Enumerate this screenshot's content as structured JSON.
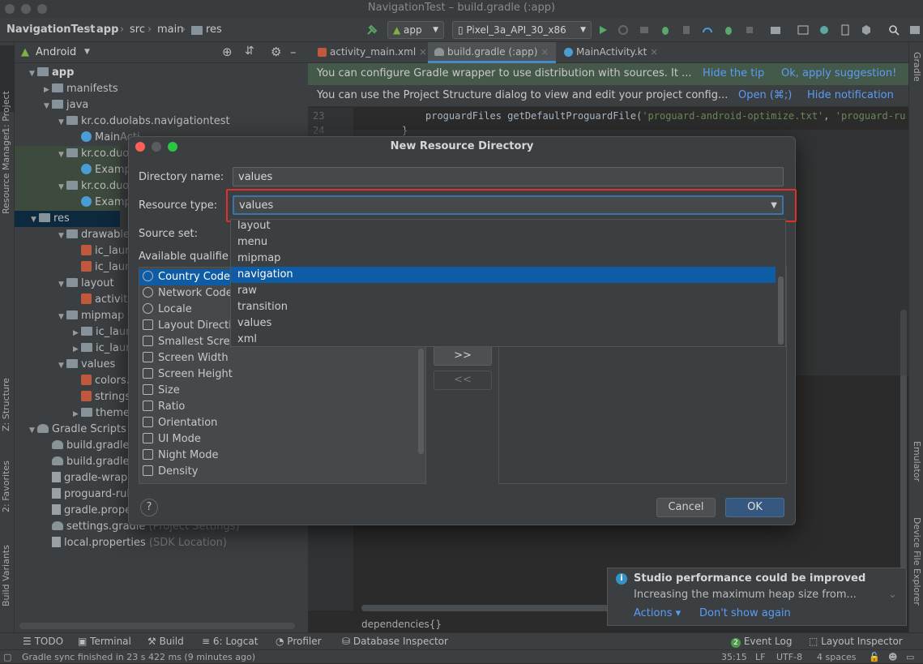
{
  "window": {
    "title": "NavigationTest – build.gradle (:app)"
  },
  "breadcrumb": {
    "items": [
      "NavigationTest",
      "app",
      "src",
      "main",
      "res"
    ]
  },
  "toolbar": {
    "run_config": "app",
    "device": "Pixel_3a_API_30_x86"
  },
  "project_panel": {
    "view_selector": "Android",
    "tree": [
      {
        "label": "app",
        "level": 0
      },
      {
        "label": "manifests",
        "level": 1
      },
      {
        "label": "java",
        "level": 1
      },
      {
        "label": "kr.co.duolabs.navigationtest",
        "level": 2
      },
      {
        "label": "MainActi",
        "level": 3
      },
      {
        "label": "kr.co.duola",
        "level": 2
      },
      {
        "label": "Exampl",
        "level": 3
      },
      {
        "label": "kr.co.duola",
        "level": 2
      },
      {
        "label": "Exampl",
        "level": 3
      },
      {
        "label": "res",
        "level": 1
      },
      {
        "label": "drawable",
        "level": 2
      },
      {
        "label": "ic_laun",
        "level": 3
      },
      {
        "label": "ic_laun",
        "level": 3
      },
      {
        "label": "layout",
        "level": 2
      },
      {
        "label": "activity",
        "level": 3
      },
      {
        "label": "mipmap",
        "level": 2
      },
      {
        "label": "ic_laun",
        "level": 3
      },
      {
        "label": "ic_laun",
        "level": 3
      },
      {
        "label": "values",
        "level": 2
      },
      {
        "label": "colors.x",
        "level": 3
      },
      {
        "label": "strings.",
        "level": 3
      },
      {
        "label": "themes",
        "level": 3
      },
      {
        "label": "Gradle Scripts",
        "level": 0
      },
      {
        "label": "build.gradle",
        "level": 1
      },
      {
        "label": "build.gradle",
        "level": 1
      },
      {
        "label": "gradle-wrap",
        "level": 1
      },
      {
        "label": "proguard-rul",
        "level": 1
      },
      {
        "label": "gradle.prope",
        "level": 1
      },
      {
        "label": "settings.gradle",
        "level": 1,
        "suffix": "(Project Settings)"
      },
      {
        "label": "local.properties",
        "level": 1,
        "suffix": "(SDK Location)"
      }
    ]
  },
  "side_tabs": {
    "left": [
      "1: Project",
      "Resource Manager",
      "Z: Structure",
      "2: Favorites",
      "Build Variants"
    ],
    "right": [
      "Gradle",
      "Emulator",
      "Device File Explorer"
    ]
  },
  "editor": {
    "tabs": [
      "activity_main.xml",
      "build.gradle (:app)",
      "MainActivity.kt"
    ],
    "banner1": {
      "text": "You can configure Gradle wrapper to use distribution with sources. It ...",
      "link1": "Hide the tip",
      "link2": "Ok, apply suggestion!"
    },
    "banner2": {
      "text": "You can use the Project Structure dialog to view and edit your project config...",
      "link1": "Open (⌘;)",
      "link2": "Hide notification"
    },
    "line_numbers": [
      "23",
      "24"
    ],
    "code_line": "proguardFiles getDefaultProguardFile(",
    "code_str1": "'proguard-android-optimize.txt'",
    "code_str2": "'proguard-ru",
    "code_brace": "}",
    "breadcrumb_bottom": "dependencies{}"
  },
  "dialog": {
    "title": "New Resource Directory",
    "directory_name_label": "Directory name:",
    "directory_name_value": "values",
    "resource_type_label": "Resource type:",
    "resource_type_value": "values",
    "source_set_label": "Source set:",
    "available_qualifiers_label": "Available qualifie",
    "qualifiers": [
      "Country Code",
      "Network Code",
      "Locale",
      "Layout Directi",
      "Smallest Scre",
      "Screen Width",
      "Screen Height",
      "Size",
      "Ratio",
      "Orientation",
      "UI Mode",
      "Night Mode",
      "Density"
    ],
    "add_button": ">>",
    "remove_button": "<<",
    "help_button": "?",
    "cancel_button": "Cancel",
    "ok_button": "OK",
    "dropdown_options": [
      "layout",
      "menu",
      "mipmap",
      "navigation",
      "raw",
      "transition",
      "values",
      "xml"
    ],
    "selected_option": "navigation"
  },
  "bottom_tools": {
    "todo": "TODO",
    "terminal": "Terminal",
    "build": "Build",
    "logcat": "6: Logcat",
    "profiler": "Profiler",
    "db_inspector": "Database Inspector",
    "event_log_count": "2",
    "event_log": "Event Log",
    "layout_inspector": "Layout Inspector"
  },
  "status_bar": {
    "message": "Gradle sync finished in 23 s 422 ms (9 minutes ago)",
    "position": "35:15",
    "line_sep": "LF",
    "encoding": "UTF-8",
    "indent": "4 spaces"
  },
  "notification": {
    "title": "Studio performance could be improved",
    "body": "Increasing the maximum heap size from...",
    "action1": "Actions ▾",
    "action2": "Don't show again"
  },
  "colors": {
    "highlight_border": "#e0302a",
    "selection": "#0d5ca5",
    "link": "#589df6"
  }
}
